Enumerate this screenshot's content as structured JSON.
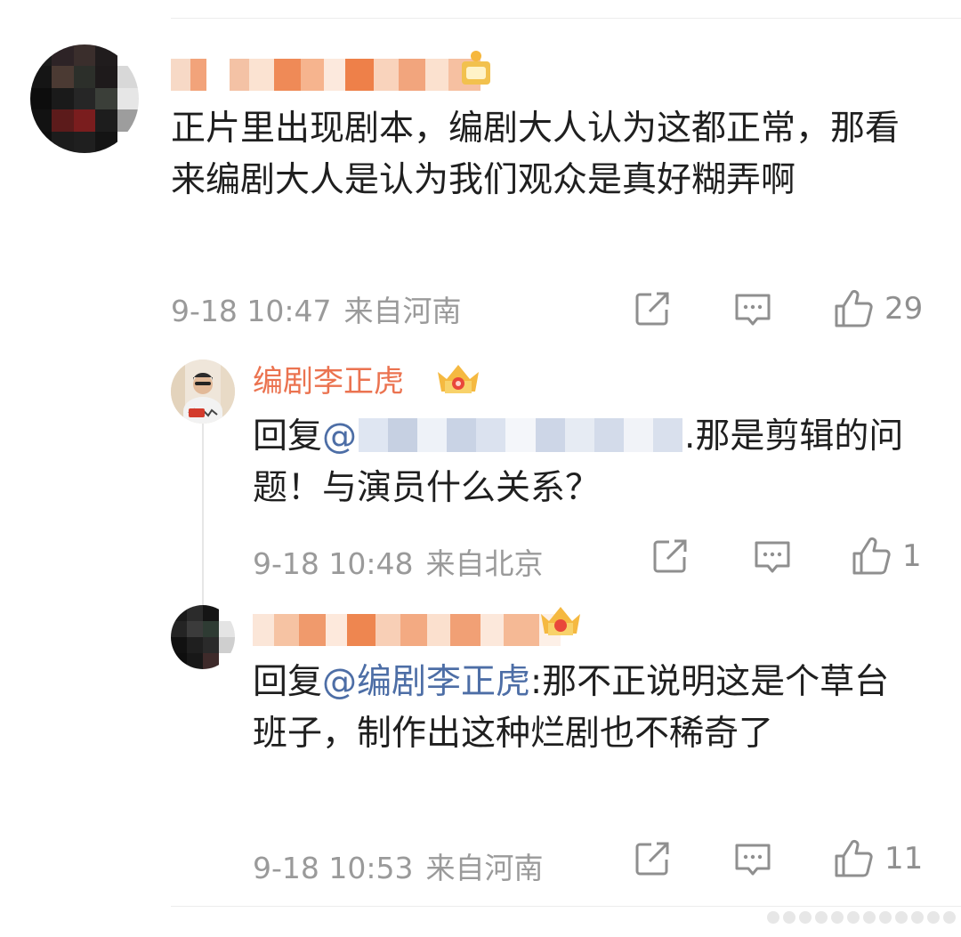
{
  "comments": [
    {
      "text": "正片里出现剧本，编剧大人认为这都正常，那看来编剧大人是认为我们观众是真好糊弄啊",
      "time": "9-18 10:47",
      "location": "来自河南",
      "likes": "29"
    }
  ],
  "replies": [
    {
      "author": "编剧李正虎",
      "reply_prefix": "回复",
      "mention_at": "@",
      "text_after": ".那是剪辑的问题！与演员什么关系？",
      "time": "9-18 10:48",
      "location": "来自北京",
      "likes": "1"
    },
    {
      "reply_prefix": "回复",
      "mention": "@编剧李正虎",
      "text_after": ":那不正说明这是个草台班子，制作出这种烂剧也不稀奇了",
      "time": "9-18 10:53",
      "location": "来自河南",
      "likes": "11"
    }
  ],
  "icons": {
    "share": "share-icon",
    "comment": "comment-icon",
    "like": "thumbs-up-icon",
    "badge": "crown-badge-icon"
  },
  "colors": {
    "author_name": "#eb7350",
    "mention": "#4d6ea6",
    "meta": "#9a9a9a"
  }
}
